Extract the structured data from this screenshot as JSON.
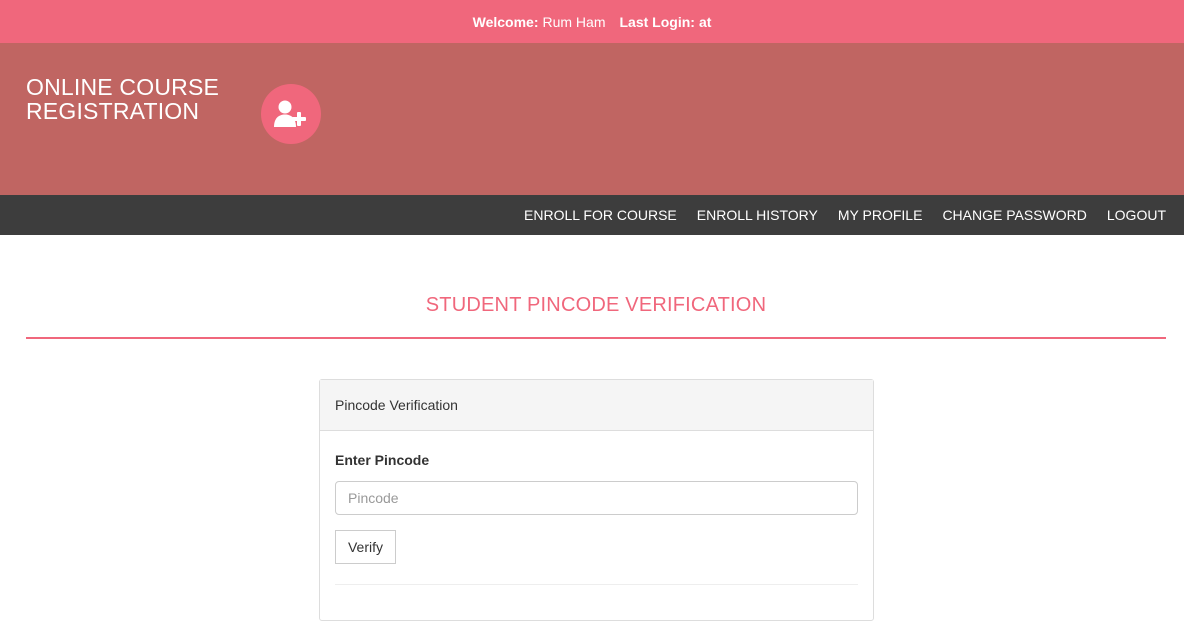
{
  "topbar": {
    "welcome_label": "Welcome:",
    "welcome_name": "Rum Ham",
    "last_login_label": "Last Login:",
    "last_login_value": "at"
  },
  "header": {
    "brand_line1": "ONLINE COURSE",
    "brand_line2": "REGISTRATION",
    "logo_icon": "user-plus-icon"
  },
  "nav": {
    "items": [
      {
        "label": "ENROLL FOR COURSE"
      },
      {
        "label": "ENROLL HISTORY"
      },
      {
        "label": "MY PROFILE"
      },
      {
        "label": "CHANGE PASSWORD"
      },
      {
        "label": "LOGOUT"
      }
    ]
  },
  "page": {
    "title": "STUDENT PINCODE VERIFICATION"
  },
  "panel": {
    "heading": "Pincode Verification",
    "field_label": "Enter Pincode",
    "input_value": "",
    "input_placeholder": "Pincode",
    "verify_label": "Verify"
  },
  "colors": {
    "accent": "#f0677c",
    "header_bg": "#c06562",
    "nav_bg": "#3d3d3d"
  }
}
